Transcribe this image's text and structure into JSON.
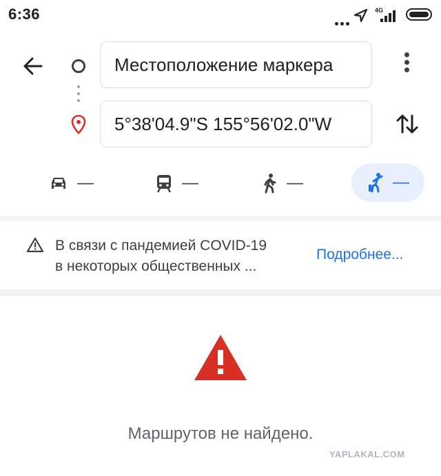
{
  "status_bar": {
    "time": "6:36",
    "network": "4G"
  },
  "directions": {
    "origin_value": "Местоположение маркера",
    "destination_value": "5°38'04.9\"S 155°56'02.0\"W"
  },
  "travel_modes": [
    {
      "name": "drive",
      "icon": "car-icon",
      "duration": "—"
    },
    {
      "name": "transit",
      "icon": "train-icon",
      "duration": "—"
    },
    {
      "name": "walk",
      "icon": "walk-icon",
      "duration": "—"
    },
    {
      "name": "ride",
      "icon": "ride-icon",
      "duration": "—",
      "selected": true
    }
  ],
  "banner": {
    "line1": "В связи с пандемией COVID-19",
    "line2": "в некоторых общественных ...",
    "link": "Подробнее..."
  },
  "result": {
    "message": "Маршрутов не найдено."
  },
  "watermark": "YAPLAKAL.COM",
  "colors": {
    "accent": "#1a73e8",
    "warning_red": "#d93025",
    "selected_bg": "#e8f0fe"
  }
}
